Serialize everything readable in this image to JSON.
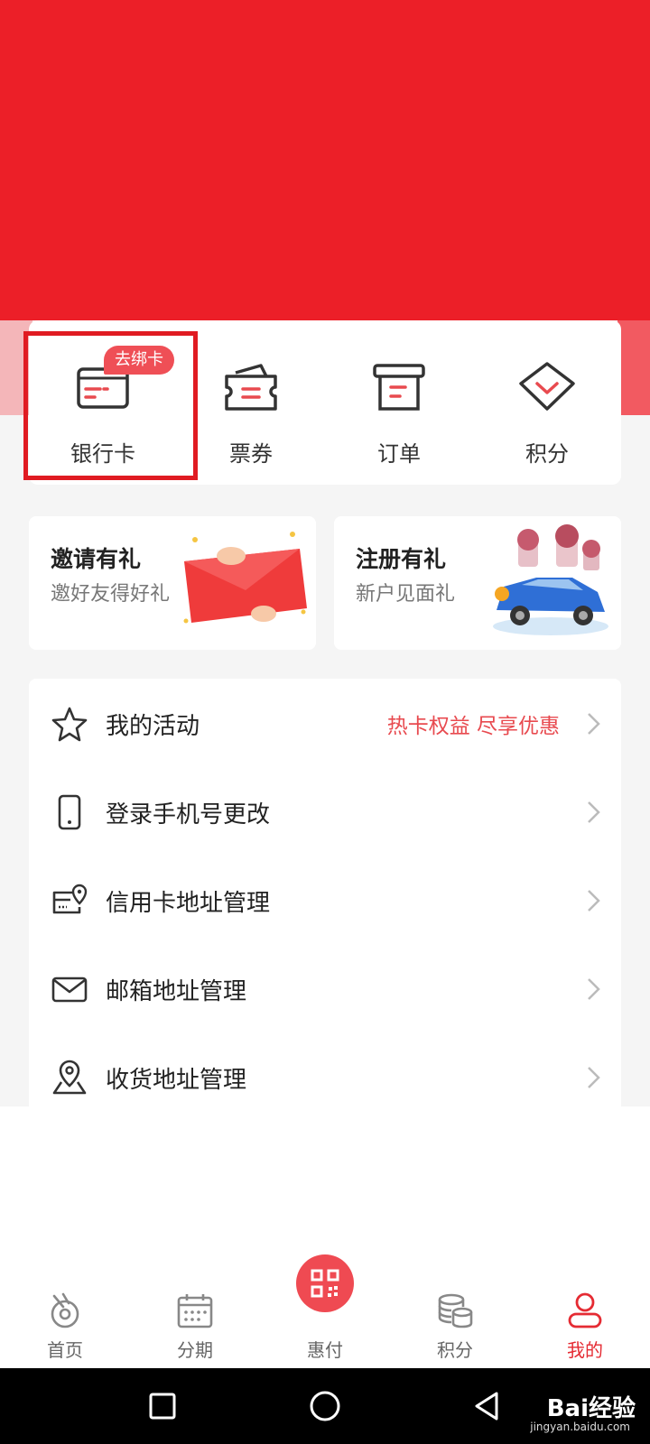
{
  "quick_access": {
    "badge": "去绑卡",
    "items": [
      {
        "label": "银行卡",
        "icon": "bank-card-icon"
      },
      {
        "label": "票券",
        "icon": "ticket-icon"
      },
      {
        "label": "订单",
        "icon": "order-icon"
      },
      {
        "label": "积分",
        "icon": "diamond-icon"
      }
    ]
  },
  "promos": [
    {
      "title": "邀请有礼",
      "subtitle": "邀好友得好礼",
      "icon": "red-envelope-illustration"
    },
    {
      "title": "注册有礼",
      "subtitle": "新户见面礼",
      "icon": "car-gift-illustration"
    }
  ],
  "menu": {
    "items": [
      {
        "label": "我的活动",
        "extra": "热卡权益 尽享优惠",
        "icon": "star-icon"
      },
      {
        "label": "登录手机号更改",
        "extra": "",
        "icon": "phone-icon"
      },
      {
        "label": "信用卡地址管理",
        "extra": "",
        "icon": "card-location-icon"
      },
      {
        "label": "邮箱地址管理",
        "extra": "",
        "icon": "mail-icon"
      },
      {
        "label": "收货地址管理",
        "extra": "",
        "icon": "location-pin-icon"
      }
    ]
  },
  "tabbar": {
    "active": "我的",
    "items": [
      {
        "label": "首页",
        "icon": "home-icon"
      },
      {
        "label": "分期",
        "icon": "calendar-icon"
      },
      {
        "label": "惠付",
        "icon": "qr-code-icon"
      },
      {
        "label": "积分",
        "icon": "coins-icon"
      },
      {
        "label": "我的",
        "icon": "user-icon"
      }
    ]
  },
  "colors": {
    "brand_red": "#ec1f28",
    "accent_text": "#e84a4f",
    "active_tab": "#e52b33"
  },
  "watermark": {
    "brand": "Bai经验",
    "url": "jingyan.baidu.com"
  }
}
